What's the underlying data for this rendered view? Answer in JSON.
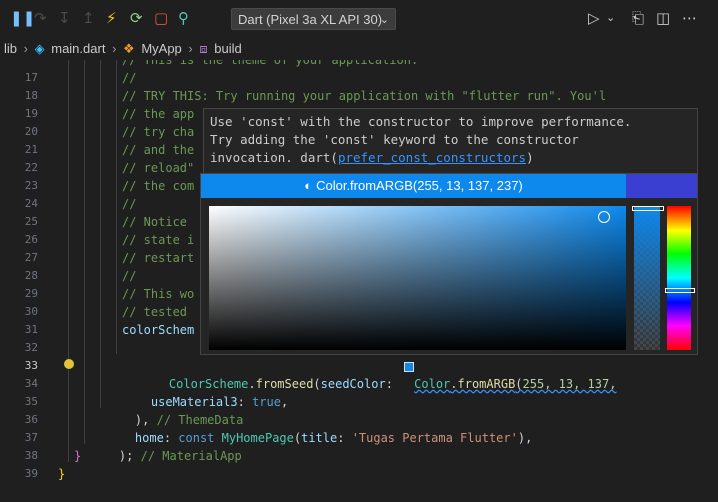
{
  "toolbar": {
    "icons": [
      "pause-icon",
      "step-over-icon",
      "step-into-icon",
      "step-out-icon",
      "hot-reload-icon",
      "hot-restart-icon",
      "stop-icon",
      "devtools-search-icon"
    ],
    "device_label": "Dart (Pixel 3a XL API 30)",
    "right_icons": [
      "run-debug-icon",
      "chevron-down-icon",
      "open-changes-icon",
      "split-editor-icon",
      "more-icon"
    ]
  },
  "breadcrumb": {
    "lib": "lib",
    "file": "main.dart",
    "class": "MyApp",
    "method": "build"
  },
  "gutter": [
    "17",
    "18",
    "19",
    "20",
    "21",
    "22",
    "23",
    "24",
    "25",
    "26",
    "27",
    "28",
    "29",
    "30",
    "31",
    "32",
    "33",
    "34",
    "35",
    "36",
    "37",
    "38",
    "39"
  ],
  "code": {
    "l16": "// This is the theme of your application.",
    "l17": "//",
    "l18": "// TRY THIS: Try running your application with \"flutter run\". You'l",
    "l19": "// the app",
    "l20": "// try cha",
    "l21": "// and the",
    "l22": "// reload\"",
    "l23": "// the com",
    "l24": "//",
    "l25": "// Notice",
    "l26": "// state i",
    "l27": "// restart",
    "l28": "//",
    "l29": "// This wo",
    "l30": "// tested",
    "l31": "colorSchem",
    "l32_a": "ColorScheme",
    "l32_b": ".",
    "l32_c": "fromSeed",
    "l32_d": "(",
    "l32_e": "seedColor",
    "l32_f": ": ",
    "l32_g": "Color",
    "l32_h": ".",
    "l32_i": "fromARGB",
    "l32_j": "(",
    "l32_k": "255, 13, 137,",
    "l33_a": "useMaterial3",
    "l33_b": ": ",
    "l33_c": "true",
    "l33_d": ",",
    "l34_a": "), ",
    "l34_b": "// ThemeData",
    "l35_a": "home",
    "l35_b": ": ",
    "l35_c": "const",
    "l35_d": " ",
    "l35_e": "MyHomePage",
    "l35_f": "(",
    "l35_g": "title",
    "l35_h": ": ",
    "l35_i": "'Tugas Pertama Flutter'",
    "l35_j": "),",
    "l36_a": "); ",
    "l36_b": "// MaterialApp",
    "l37": "}",
    "l38": "}"
  },
  "hover": {
    "line1": "Use 'const' with the constructor to improve performance.",
    "line2": "Try adding the 'const' keyword to the constructor",
    "line3_a": "invocation. dart(",
    "line3_link": "prefer_const_constructors",
    "line3_b": ")"
  },
  "color_picker": {
    "label": "Color.fromARGB(255, 13, 137, 237)",
    "color": "#0d89ed",
    "original_color": "#3b3fd1",
    "hue_level": 0.57,
    "opacity_level": 1.0
  }
}
